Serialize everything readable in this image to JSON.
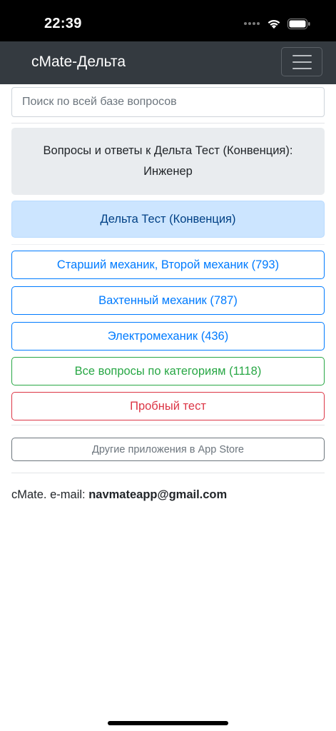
{
  "status_bar": {
    "time": "22:39",
    "icons": [
      "signal-dots-icon",
      "wifi-icon",
      "battery-icon"
    ]
  },
  "navbar": {
    "brand": "cMate-Дельта",
    "toggler_icon": "hamburger-menu-icon"
  },
  "search": {
    "placeholder": "Поиск по всей базе вопросов"
  },
  "intro": {
    "line1": "Вопросы и ответы к Дельта Тест (Конвенция):",
    "line2": "Инженер"
  },
  "info_banner": {
    "label": "Дельта Тест (Конвенция)"
  },
  "categories": [
    {
      "label": "Старший механик, Второй механик (793)"
    },
    {
      "label": "Вахтенный механик (787)"
    },
    {
      "label": "Электромеханик (436)"
    }
  ],
  "all_questions": {
    "label": "Все вопросы по категориям (1118)"
  },
  "trial_test": {
    "label": "Пробный тест"
  },
  "other_apps": {
    "label": "Другие приложения в App Store"
  },
  "footer": {
    "prefix": "cMate. e-mail: ",
    "email": "navmateapp@gmail.com"
  },
  "colors": {
    "navbar": "#343a40",
    "primary": "#007bff",
    "success": "#28a745",
    "danger": "#dc3545",
    "secondary": "#6c757d",
    "info_bg": "#cce5ff",
    "info_text": "#004085",
    "jumbotron_bg": "#e9ecef"
  }
}
